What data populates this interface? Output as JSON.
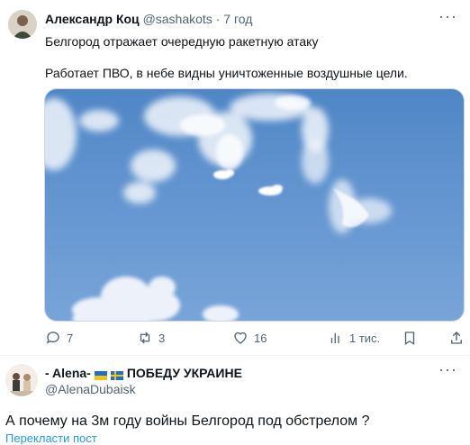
{
  "tweet1": {
    "author_name": "Александр Коц",
    "author_handle": "@sashakots",
    "dot": "·",
    "time": "7 год",
    "text_line1": "Белгород отражает очередную ракетную атаку",
    "text_line2": "Работает ПВО, в небе видны уничтоженные воздушные цели.",
    "more_icon": "more-horizontal-icon",
    "actions": {
      "reply_count": "7",
      "retweet_count": "3",
      "like_count": "16",
      "views_count": "1 тис."
    }
  },
  "tweet2": {
    "author_name": "- Alena-",
    "author_name_suffix": "ПОБЕДУ УКРАИНЕ",
    "author_handle": "@AlenaDubaisk",
    "more_icon": "more-horizontal-icon",
    "reply_text": "А почему на 3м году войны Белгород под обстрелом ?",
    "translate_link": "Перекласти пост"
  },
  "colors": {
    "accent": "#1d9bf0",
    "secondary_text": "#536471",
    "sky": "#5f8fc9"
  }
}
